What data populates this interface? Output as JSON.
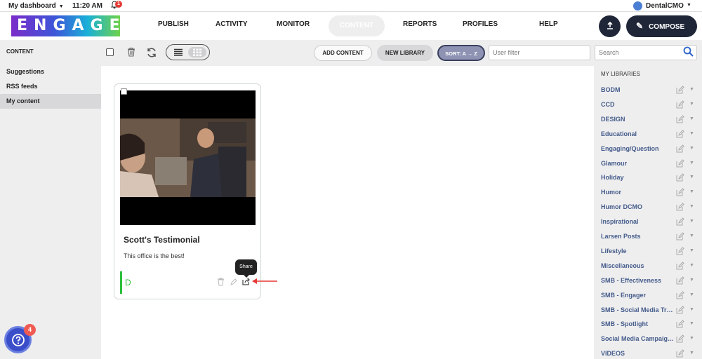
{
  "topbar": {
    "dashboard_label": "My dashboard",
    "time": "11:20 AM",
    "notification_count": "1",
    "user_name": "DentalCMO"
  },
  "navbar": {
    "logo_text": "ENGAGER",
    "items": [
      "PUBLISH",
      "ACTIVITY",
      "MONITOR",
      "CONTENT",
      "REPORTS",
      "PROFILES",
      "HELP"
    ],
    "active_item": "CONTENT",
    "compose_label": "COMPOSE"
  },
  "sidebar": {
    "section_title": "CONTENT",
    "items": [
      "Suggestions",
      "RSS feeds",
      "My content"
    ],
    "active_item": "My content"
  },
  "toolbar": {
    "add_content_label": "ADD CONTENT",
    "new_library_label": "NEW LIBRARY",
    "sort_label": "SORT: A → Z",
    "user_filter_placeholder": "User filter",
    "search_placeholder": "Search"
  },
  "card": {
    "title": "Scott's Testimonial",
    "description": "This office is the best!",
    "library_initial": "D",
    "share_tooltip": "Share"
  },
  "libraries": {
    "header": "MY LIBRARIES",
    "items": [
      "BODM",
      "CCD",
      "DESIGN",
      "Educational",
      "Engaging/Question",
      "Glamour",
      "Holiday",
      "Humor",
      "Humor DCMO",
      "Inspirational",
      "Larsen Posts",
      "Lifestyle",
      "Miscellaneous",
      "SMB - Effectiveness",
      "SMB - Engager",
      "SMB - Social Media Trai...",
      "SMB - Spotlight",
      "Social Media Campaign...",
      "VIDEOS"
    ]
  },
  "help": {
    "badge_count": "4"
  },
  "colors": {
    "accent_dark": "#1f2638",
    "library_link": "#445b8a",
    "green_tag": "#2bbf3b",
    "badge_red": "#e53935"
  }
}
